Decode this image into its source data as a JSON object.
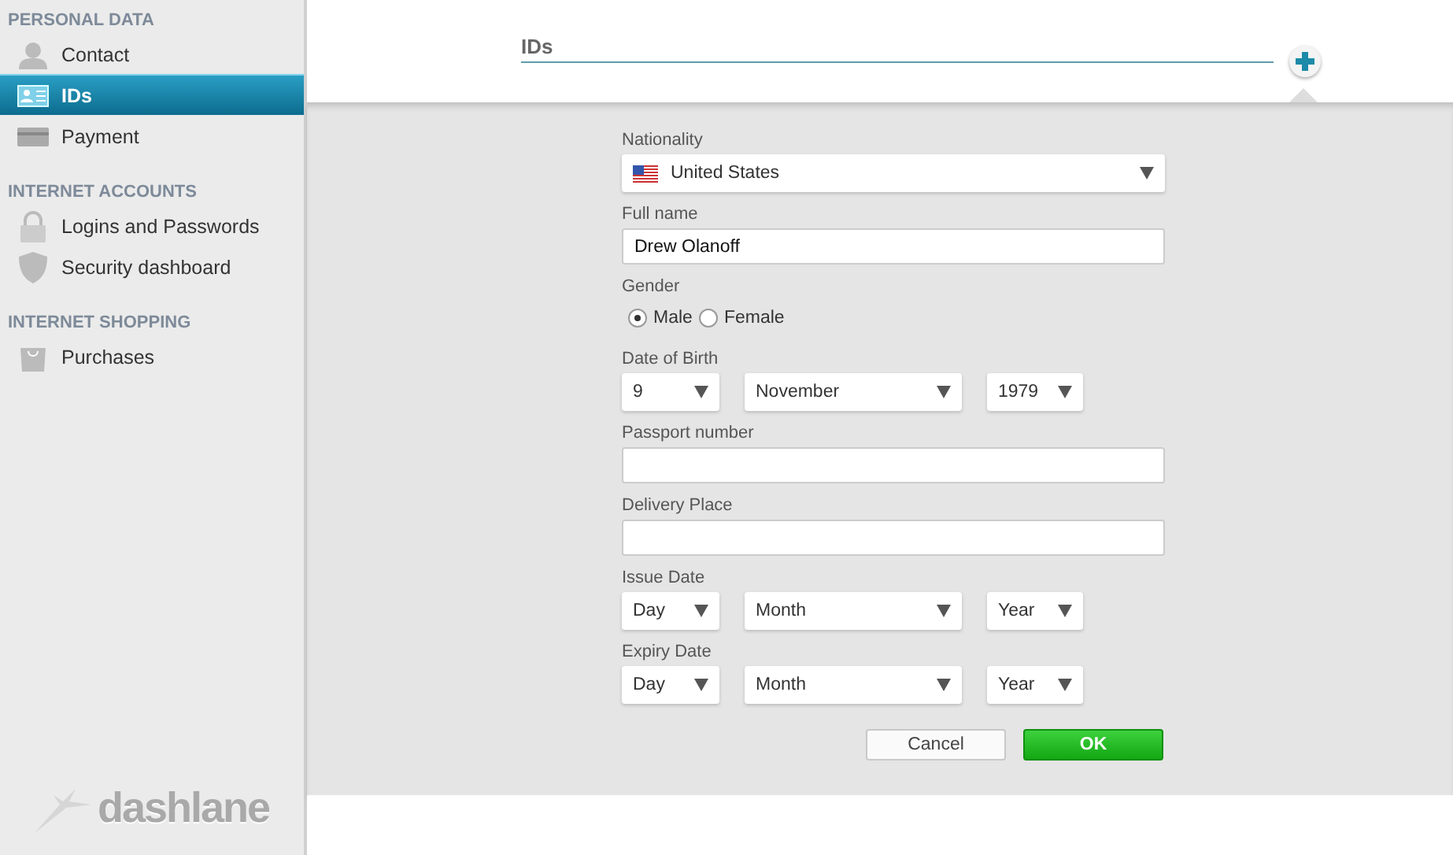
{
  "sidebar": {
    "sections": [
      {
        "heading": "PERSONAL DATA",
        "items": [
          {
            "label": "Contact",
            "selected": false
          },
          {
            "label": "IDs",
            "selected": true
          },
          {
            "label": "Payment",
            "selected": false
          }
        ]
      },
      {
        "heading": "INTERNET ACCOUNTS",
        "items": [
          {
            "label": "Logins and Passwords",
            "selected": false
          },
          {
            "label": "Security dashboard",
            "selected": false
          }
        ]
      },
      {
        "heading": "INTERNET SHOPPING",
        "items": [
          {
            "label": "Purchases",
            "selected": false
          }
        ]
      }
    ],
    "logo": "dashlane"
  },
  "header": {
    "title": "IDs"
  },
  "form": {
    "fields": [
      {
        "kind": "select",
        "label": "Nationality",
        "value": "United States"
      },
      {
        "kind": "text",
        "label": "Full name",
        "value": "Drew Olanoff"
      },
      {
        "kind": "radio",
        "label": "Gender",
        "options": [
          {
            "label": "Male",
            "selected": true
          },
          {
            "label": "Female",
            "selected": false
          }
        ]
      },
      {
        "kind": "date",
        "label": "Date of Birth",
        "parts": [
          "9",
          "November",
          "1979"
        ]
      },
      {
        "kind": "text",
        "label": "Passport number"
      },
      {
        "kind": "text",
        "label": "Delivery Place"
      },
      {
        "kind": "date",
        "label": "Issue Date",
        "parts": [
          "Day",
          "Month",
          "Year"
        ]
      },
      {
        "kind": "date",
        "label": "Expiry Date",
        "parts": [
          "Day",
          "Month",
          "Year"
        ]
      }
    ],
    "buttons": [
      {
        "label": "Cancel",
        "kind": "secondary"
      },
      {
        "label": "OK",
        "kind": "primary"
      }
    ]
  }
}
